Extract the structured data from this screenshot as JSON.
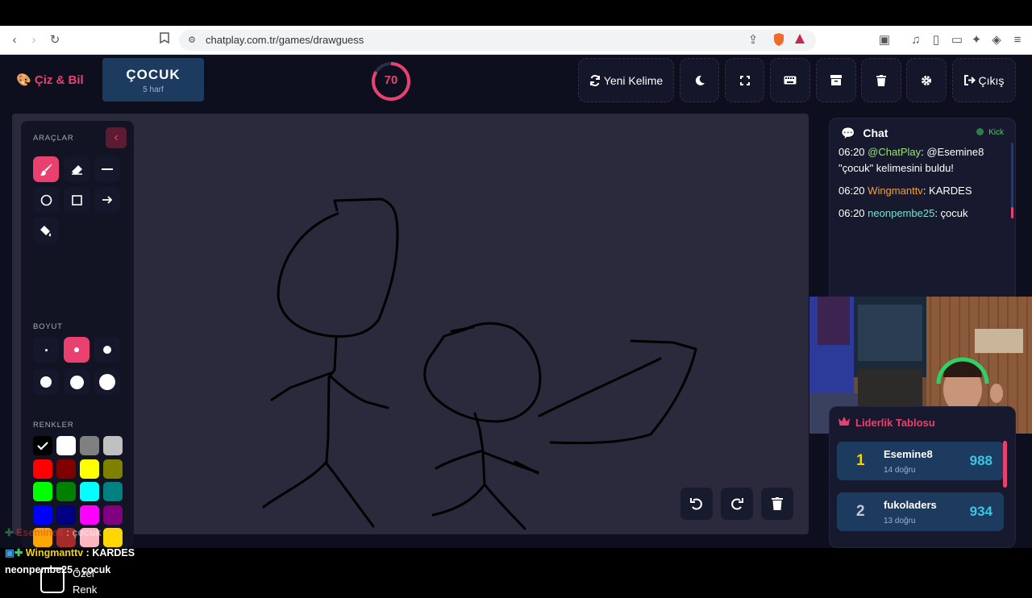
{
  "browser": {
    "url": "chatplay.com.tr/games/drawguess",
    "shield_count": "1"
  },
  "header": {
    "logo_text": "Çiz & Bil",
    "word": "ÇOCUK",
    "word_hint": "5 harf",
    "timer": "70",
    "new_word_label": "Yeni Kelime",
    "exit_label": "Çıkış"
  },
  "tools": {
    "section_tools": "ARAÇLAR",
    "section_size": "BOYUT",
    "section_colors": "RENKLER",
    "custom_color_label": "Özel Renk",
    "colors": [
      "#000000",
      "#ffffff",
      "#808080",
      "#c0c0c0",
      "#ff0000",
      "#800000",
      "#ffff00",
      "#808000",
      "#00ff00",
      "#008000",
      "#00ffff",
      "#008080",
      "#0000ff",
      "#000080",
      "#ff00ff",
      "#800080",
      "#ffa500",
      "#a52a2a",
      "#ffb6c1",
      "#ffd700"
    ]
  },
  "chat": {
    "title": "Chat",
    "platform": "Kick",
    "messages": [
      {
        "time": "06:20",
        "user": "@ChatPlay",
        "user_color": "#9ee07a",
        "text": "@Esemine8 \"çocuk\" kelimesini buldu!"
      },
      {
        "time": "06:20",
        "user": "Wingmanttv",
        "user_color": "#f0a040",
        "text": "KARDES"
      },
      {
        "time": "06:20",
        "user": "neonpembe25",
        "user_color": "#7ee0d0",
        "text": "çocuk"
      }
    ]
  },
  "leaderboard": {
    "title": "Liderlik Tablosu",
    "rows": [
      {
        "rank": "1",
        "rank_color": "#f5d400",
        "name": "Esemine8",
        "sub": "14 doğru",
        "score": "988"
      },
      {
        "rank": "2",
        "rank_color": "#c0c8d8",
        "name": "fukoladers",
        "sub": "13 doğru",
        "score": "934"
      }
    ]
  },
  "overlay_chat": [
    {
      "user": "Esemine8",
      "text": "çocuk",
      "user_color": "#d23c3c"
    },
    {
      "user": "Wingmanttv",
      "text": "KARDES",
      "user_color": "#f5d400"
    },
    {
      "user": "neonpembe25",
      "text": "çocuk",
      "user_color": "#ffffff"
    }
  ]
}
